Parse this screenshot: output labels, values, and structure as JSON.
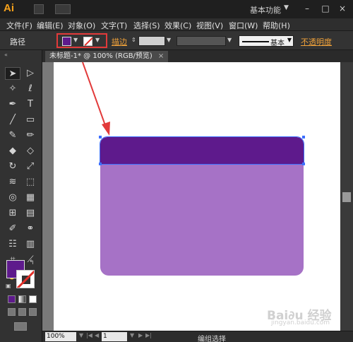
{
  "app": {
    "logo": "Ai",
    "workspace": "基本功能",
    "window_controls": [
      "–",
      "□",
      "×"
    ]
  },
  "menu": [
    "文件(F)",
    "编辑(E)",
    "对象(O)",
    "文字(T)",
    "选择(S)",
    "效果(C)",
    "视图(V)",
    "窗口(W)",
    "帮助(H)"
  ],
  "control_bar": {
    "object_type": "路径",
    "fill_color": "#5e1a8c",
    "stroke_label": "描边",
    "stroke_style": "基本",
    "opacity_label": "不透明度"
  },
  "document": {
    "tab_title": "未标题-1* @ 100% (RGB/预览)",
    "close": "×"
  },
  "canvas": {
    "shape_body_color": "#a672c6",
    "shape_top_color": "#5e1a8c",
    "arrow_color": "#e23a3a"
  },
  "status": {
    "zoom": "100%",
    "page": "1",
    "text": "编组选择"
  },
  "watermark": {
    "main": "Bai∂u 经验",
    "sub": "jingyan.baidu.com"
  }
}
